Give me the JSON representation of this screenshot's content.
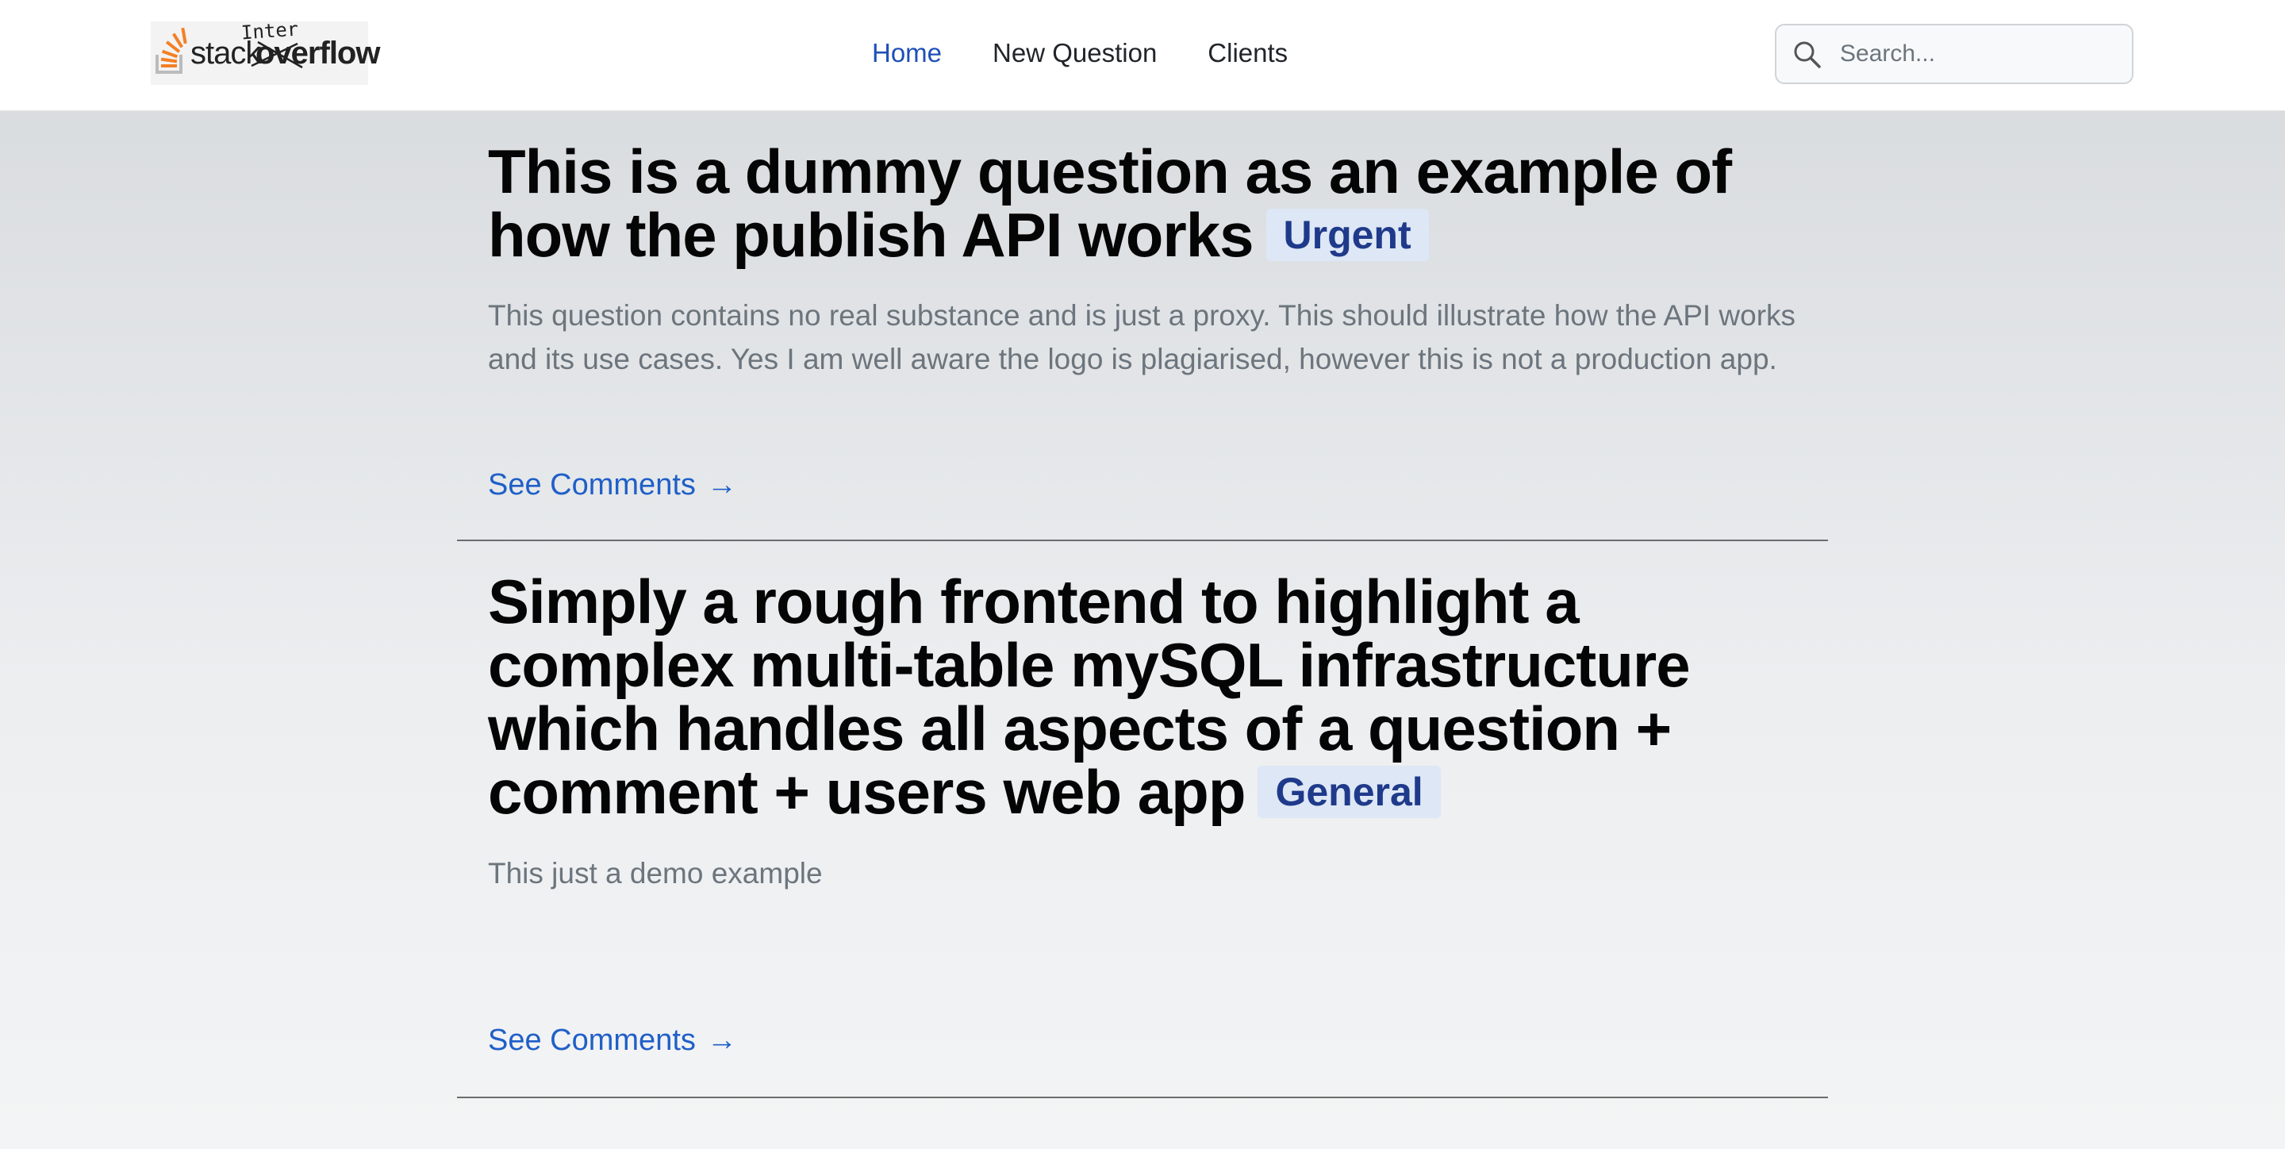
{
  "header": {
    "logo": {
      "word_stack": "stack",
      "word_overflow": "overflow",
      "word_inter": "Inter"
    },
    "nav": [
      {
        "label": "Home",
        "active": true
      },
      {
        "label": "New Question",
        "active": false
      },
      {
        "label": "Clients",
        "active": false
      }
    ],
    "search": {
      "placeholder": "Search..."
    }
  },
  "questions": [
    {
      "title": "This is a dummy question as an example of how the publish API works",
      "tag": "Urgent",
      "body": "This question contains no real substance and is just a proxy. This should illustrate how the API works and its use cases. Yes I am well aware the logo is plagiarised, however this is not a production app.",
      "link_label": "See Comments",
      "link_arrow": "→"
    },
    {
      "title": "Simply a rough frontend to highlight a complex multi-table mySQL infrastructure which handles all aspects of a question + comment + users web app",
      "tag": "General",
      "body": "This just a demo example",
      "link_label": "See Comments",
      "link_arrow": "→"
    }
  ],
  "colors": {
    "nav_active": "#1f4fb8",
    "link": "#1f5fc8",
    "badge_bg": "#dde7f5",
    "badge_text": "#1f3a8a",
    "logo_orange": "#f48024"
  }
}
